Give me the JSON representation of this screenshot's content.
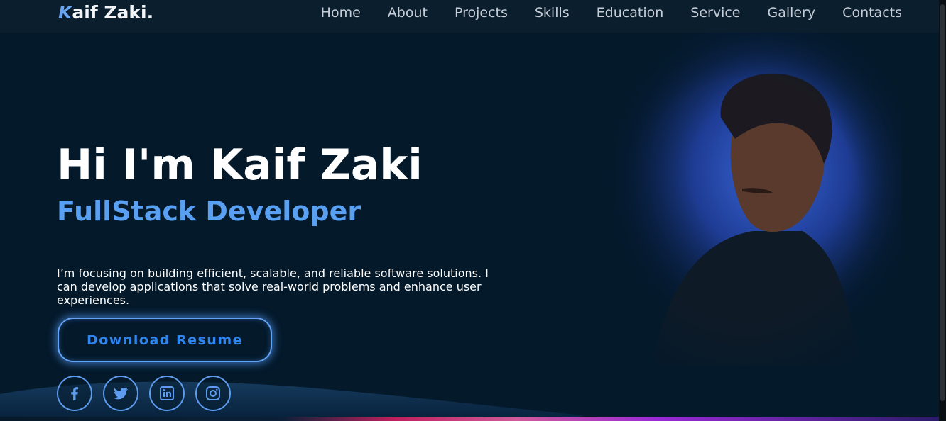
{
  "brand": {
    "initial": "K",
    "rest": "aif Zaki."
  },
  "nav": {
    "items": [
      "Home",
      "About",
      "Projects",
      "Skills",
      "Education",
      "Service",
      "Gallery",
      "Contacts"
    ]
  },
  "hero": {
    "title": "Hi I'm Kaif Zaki",
    "subtitle": "FullStack Developer",
    "description": "I’m focusing on building efficient, scalable, and reliable software solutions. I can develop applications that solve real-world problems and enhance user experiences.",
    "resume_label": "Download Resume"
  },
  "social": [
    {
      "icon": "facebook-icon"
    },
    {
      "icon": "twitter-icon"
    },
    {
      "icon": "linkedin-icon"
    },
    {
      "icon": "instagram-icon"
    }
  ],
  "colors": {
    "background": "#04192a",
    "accent": "#5aa0f2",
    "button_text": "#2e86f0",
    "nav_text": "#c6cdd6"
  }
}
